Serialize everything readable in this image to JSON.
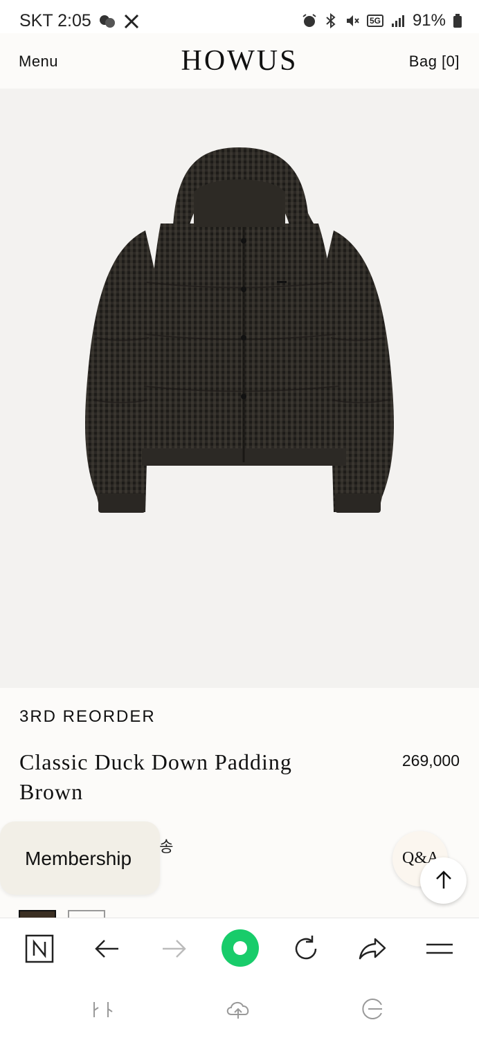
{
  "status_bar": {
    "carrier_time": "SKT 2:05",
    "battery": "91%",
    "network": "5G"
  },
  "header": {
    "menu_label": "Menu",
    "logo": "HOWUS",
    "bag_label": "Bag [0]"
  },
  "product": {
    "tag": "3RD REORDER",
    "name": "Classic Duck Down Padding Brown",
    "price": "269,000",
    "delivery_fragment": "배송",
    "image": "brown-check-puffer-jacket"
  },
  "floating": {
    "membership_label": "Membership",
    "qa_label": "Q&A"
  },
  "browser_bar": {
    "icons": [
      "naver-n-icon",
      "back-arrow-icon",
      "forward-arrow-icon",
      "home-icon",
      "reload-icon",
      "share-icon",
      "hamburger-menu-icon"
    ],
    "home_color": "#18cc6a"
  },
  "system_nav": {
    "icons": [
      "recent-apps-icon",
      "cloud-icon",
      "home-gesture-icon"
    ]
  }
}
